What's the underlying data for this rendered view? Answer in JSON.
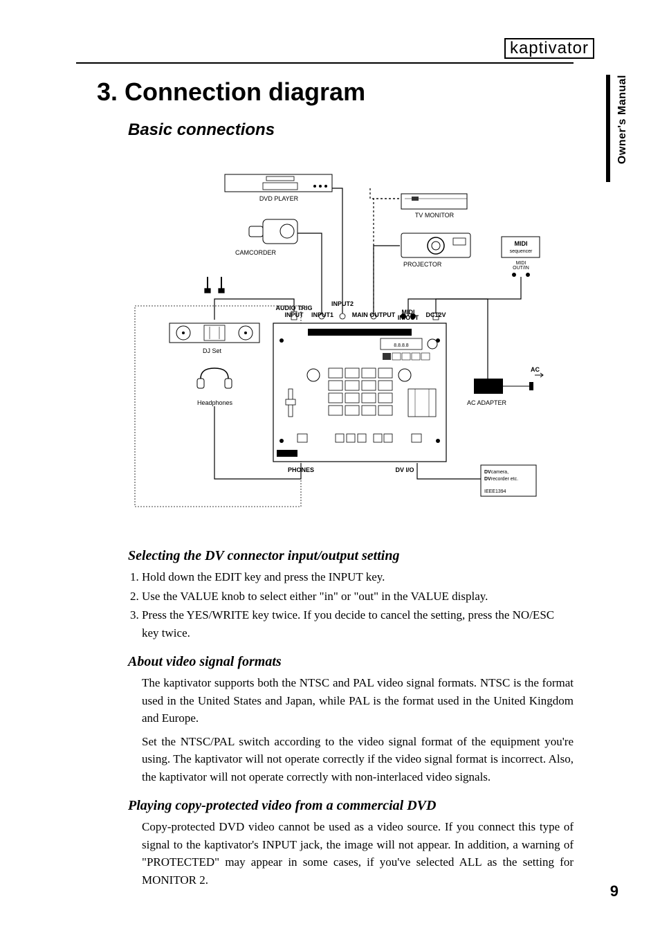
{
  "header": {
    "product": "kaptivator",
    "side_tab": "Owner's Manual"
  },
  "chapter": {
    "number": "3.",
    "title": "Connection diagram"
  },
  "section_basic": "Basic connections",
  "diagram": {
    "dvd": "DVD PLAYER",
    "camcorder": "CAMCORDER",
    "tv": "TV MONITOR",
    "projector": "PROJECTOR",
    "midi_seq": "MIDI",
    "midi_seq2": "sequencer",
    "midi_outin": "MIDI",
    "midi_outin2": "OUT/IN",
    "audio_trig": "AUDIO TRIG",
    "audio_trig_input": "INPUT",
    "input1": "INPUT1",
    "input2": "INPUT2",
    "main_out": "MAIN OUTPUT",
    "midi_inout": "MIDI",
    "midi_inout2": "IN/OUT",
    "dc12v": "DC12V",
    "dj": "DJ Set",
    "headphones": "Headphones",
    "phones": "PHONES",
    "dvio": "DV I/O",
    "ac_adapter": "AC ADAPTER",
    "ac": "AC",
    "dv_cam": "DV",
    "dv_cam2": "camera,",
    "dv_rec": "DV",
    "dv_rec2": "recorder etc.",
    "ieee": "IEEE1394"
  },
  "sub_dv": "Selecting the DV connector input/output setting",
  "steps_dv": [
    "Hold down the EDIT key and press the INPUT key.",
    "Use the VALUE knob to select either \"in\" or \"out\" in the VALUE display.",
    "Press the YES/WRITE key twice. If you decide to cancel the setting, press the NO/ESC key twice."
  ],
  "sub_video": "About video signal formats",
  "para_video1": "The kaptivator supports both the NTSC and PAL video signal formats. NTSC is the format used in the United States and Japan, while PAL is the format used in the United Kingdom and Europe.",
  "para_video2": "Set the NTSC/PAL switch according to the video signal format of the equipment you're using. The kaptivator will not operate correctly if the video signal format is incorrect. Also, the kaptivator will not operate correctly with non-interlaced video signals.",
  "sub_copy": "Playing copy-protected video from a commercial DVD",
  "para_copy": "Copy-protected DVD video cannot be used as a video source. If you connect this type of signal to the kaptivator's INPUT jack, the image will not appear. In addition, a warning of \"PROTECTED\" may appear in some cases, if you've selected ALL as the setting for MONITOR 2.",
  "page_number": "9"
}
